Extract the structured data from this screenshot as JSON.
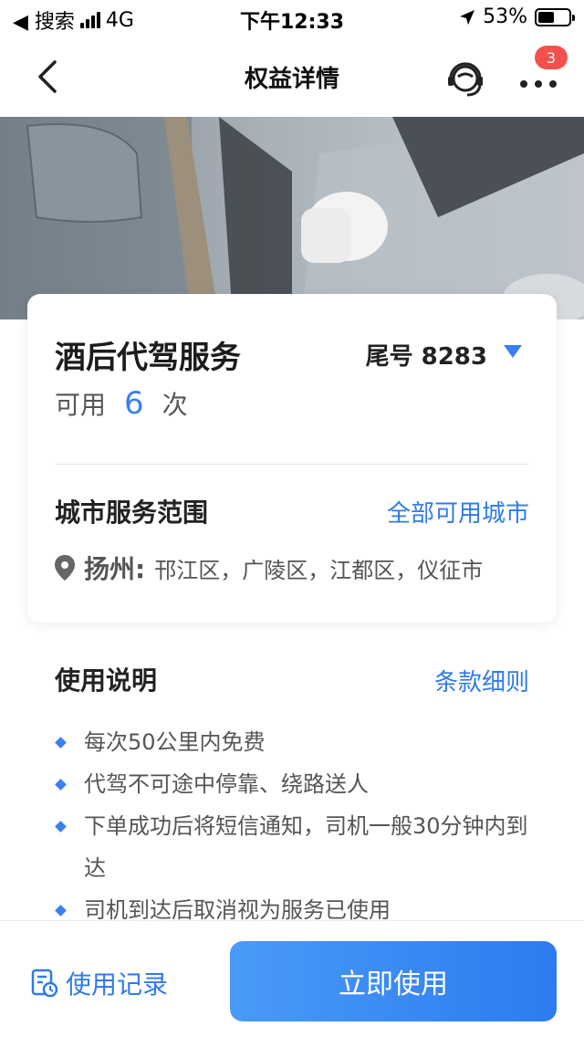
{
  "status_bar": {
    "back_app": "◀ 搜索",
    "network": "4G",
    "time": "下午12:33",
    "battery_percent": "53%",
    "battery_level": 0.53
  },
  "nav": {
    "title": "权益详情",
    "badge_count": "3",
    "icons": {
      "back": "back-chevron-icon",
      "service": "customer-service-icon",
      "more": "more-dots-icon"
    }
  },
  "benefit": {
    "title": "酒后代驾服务",
    "tail_number": "尾号 8283",
    "available_prefix": "可用",
    "available_count": "6",
    "available_suffix": "次",
    "range_title": "城市服务范围",
    "range_link": "全部可用城市",
    "city": "扬州:",
    "districts": "邗江区，广陵区，江都区，仪征市"
  },
  "usage": {
    "title": "使用说明",
    "terms_link": "条款细则",
    "rules": [
      "每次50公里内免费",
      "代驾不可途中停靠、绕路送人",
      "下单成功后将短信通知，司机一般30分钟内到达",
      "司机到达后取消视为服务已使用"
    ]
  },
  "footer": {
    "records_label": "使用记录",
    "use_button_label": "立即使用"
  },
  "colors": {
    "accent": "#3c7ff0",
    "link": "#2f7be8",
    "badge": "#f4504e"
  }
}
